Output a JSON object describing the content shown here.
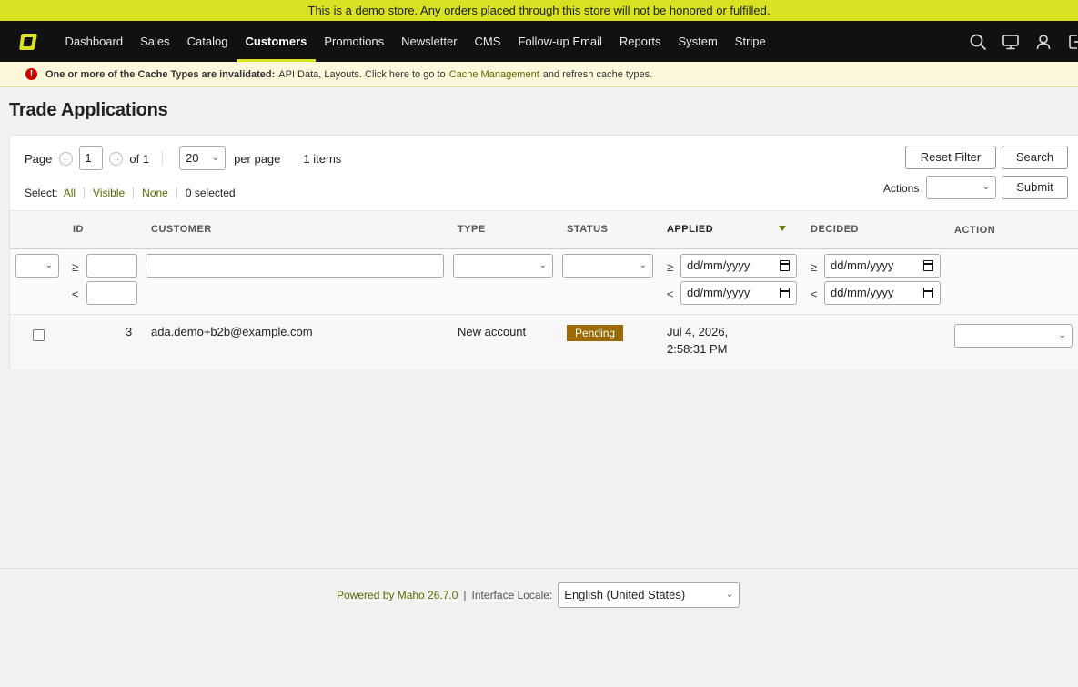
{
  "demo_notice": "This is a demo store. Any orders placed through this store will not be honored or fulfilled.",
  "nav": {
    "items": [
      {
        "label": "Dashboard",
        "active": false
      },
      {
        "label": "Sales",
        "active": false
      },
      {
        "label": "Catalog",
        "active": false
      },
      {
        "label": "Customers",
        "active": true
      },
      {
        "label": "Promotions",
        "active": false
      },
      {
        "label": "Newsletter",
        "active": false
      },
      {
        "label": "CMS",
        "active": false
      },
      {
        "label": "Follow-up Email",
        "active": false
      },
      {
        "label": "Reports",
        "active": false
      },
      {
        "label": "System",
        "active": false
      },
      {
        "label": "Stripe",
        "active": false
      }
    ],
    "icons": [
      "search-icon",
      "monitor-icon",
      "user-icon",
      "logout-icon"
    ]
  },
  "cache_notice": {
    "bold": "One or more of the Cache Types are invalidated:",
    "text_before_link": "API Data, Layouts. Click here to go to",
    "link": "Cache Management",
    "text_after_link": "and refresh cache types."
  },
  "page_title": "Trade Applications",
  "pager": {
    "page_label": "Page",
    "page_value": "1",
    "of_label": "of 1",
    "per_page_value": "20",
    "per_page_label": "per page",
    "items_label": "1 items"
  },
  "select": {
    "label": "Select:",
    "all": "All",
    "visible": "Visible",
    "none": "None",
    "selected": "0 selected"
  },
  "buttons": {
    "reset_filter": "Reset Filter",
    "search": "Search",
    "submit": "Submit"
  },
  "actions_label": "Actions",
  "columns": {
    "id": "ID",
    "customer": "CUSTOMER",
    "type": "TYPE",
    "status": "STATUS",
    "applied": "APPLIED",
    "decided": "DECIDED",
    "action": "ACTION"
  },
  "filters": {
    "gte": "≥",
    "lte": "≤",
    "date_placeholder": "dd/mm/yyyy"
  },
  "row": {
    "id": "3",
    "customer": "ada.demo+b2b@example.com",
    "type": "New account",
    "status": "Pending",
    "status_color": "#9c6a00",
    "applied_line1": "Jul 4, 2026,",
    "applied_line2": "2:58:31 PM"
  },
  "footer": {
    "powered_by": "Powered by Maho 26.7.0",
    "locale_label": "Interface Locale:",
    "locale_value": "English (United States)"
  },
  "colors": {
    "accent": "#d8e223",
    "link": "#5a6a00",
    "nav_bg": "#111111"
  }
}
